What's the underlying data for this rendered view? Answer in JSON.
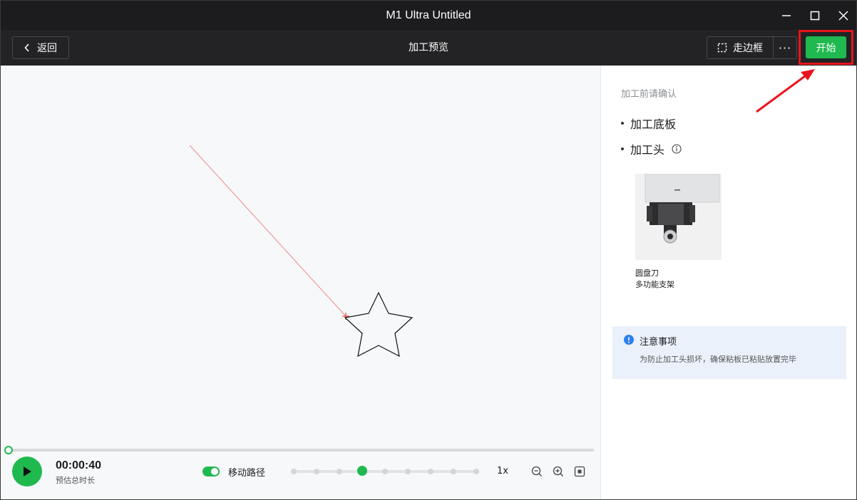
{
  "window": {
    "title": "M1 Ultra Untitled",
    "controls": [
      "minimize-icon",
      "maximize-icon",
      "close-icon"
    ]
  },
  "toolbar": {
    "back_label": "返回",
    "page_title": "加工预览",
    "frame_label": "走边框",
    "more_label": "···",
    "start_label": "开始"
  },
  "colors": {
    "accent": "#1fb94f",
    "highlight": "#e8141b",
    "titlebar": "#1c1c1e",
    "canvas_bg": "#f7f8fa"
  },
  "playback": {
    "time": "00:00:40",
    "time_label": "预估总时长",
    "path_toggle_label": "移动路径",
    "path_toggle_on": true,
    "speed_value": "1x",
    "speed_steps": 9,
    "speed_selected_index": 3,
    "progress": 0
  },
  "panel": {
    "heading": "加工前请确认",
    "items": [
      {
        "label": "加工底板"
      },
      {
        "label": "加工头"
      }
    ],
    "tool": {
      "name": "圆盘刀",
      "mount": "多功能支架"
    },
    "notice": {
      "title": "注意事项",
      "text": "为防止加工头损坏，确保粘板已粘贴放置完毕"
    }
  }
}
